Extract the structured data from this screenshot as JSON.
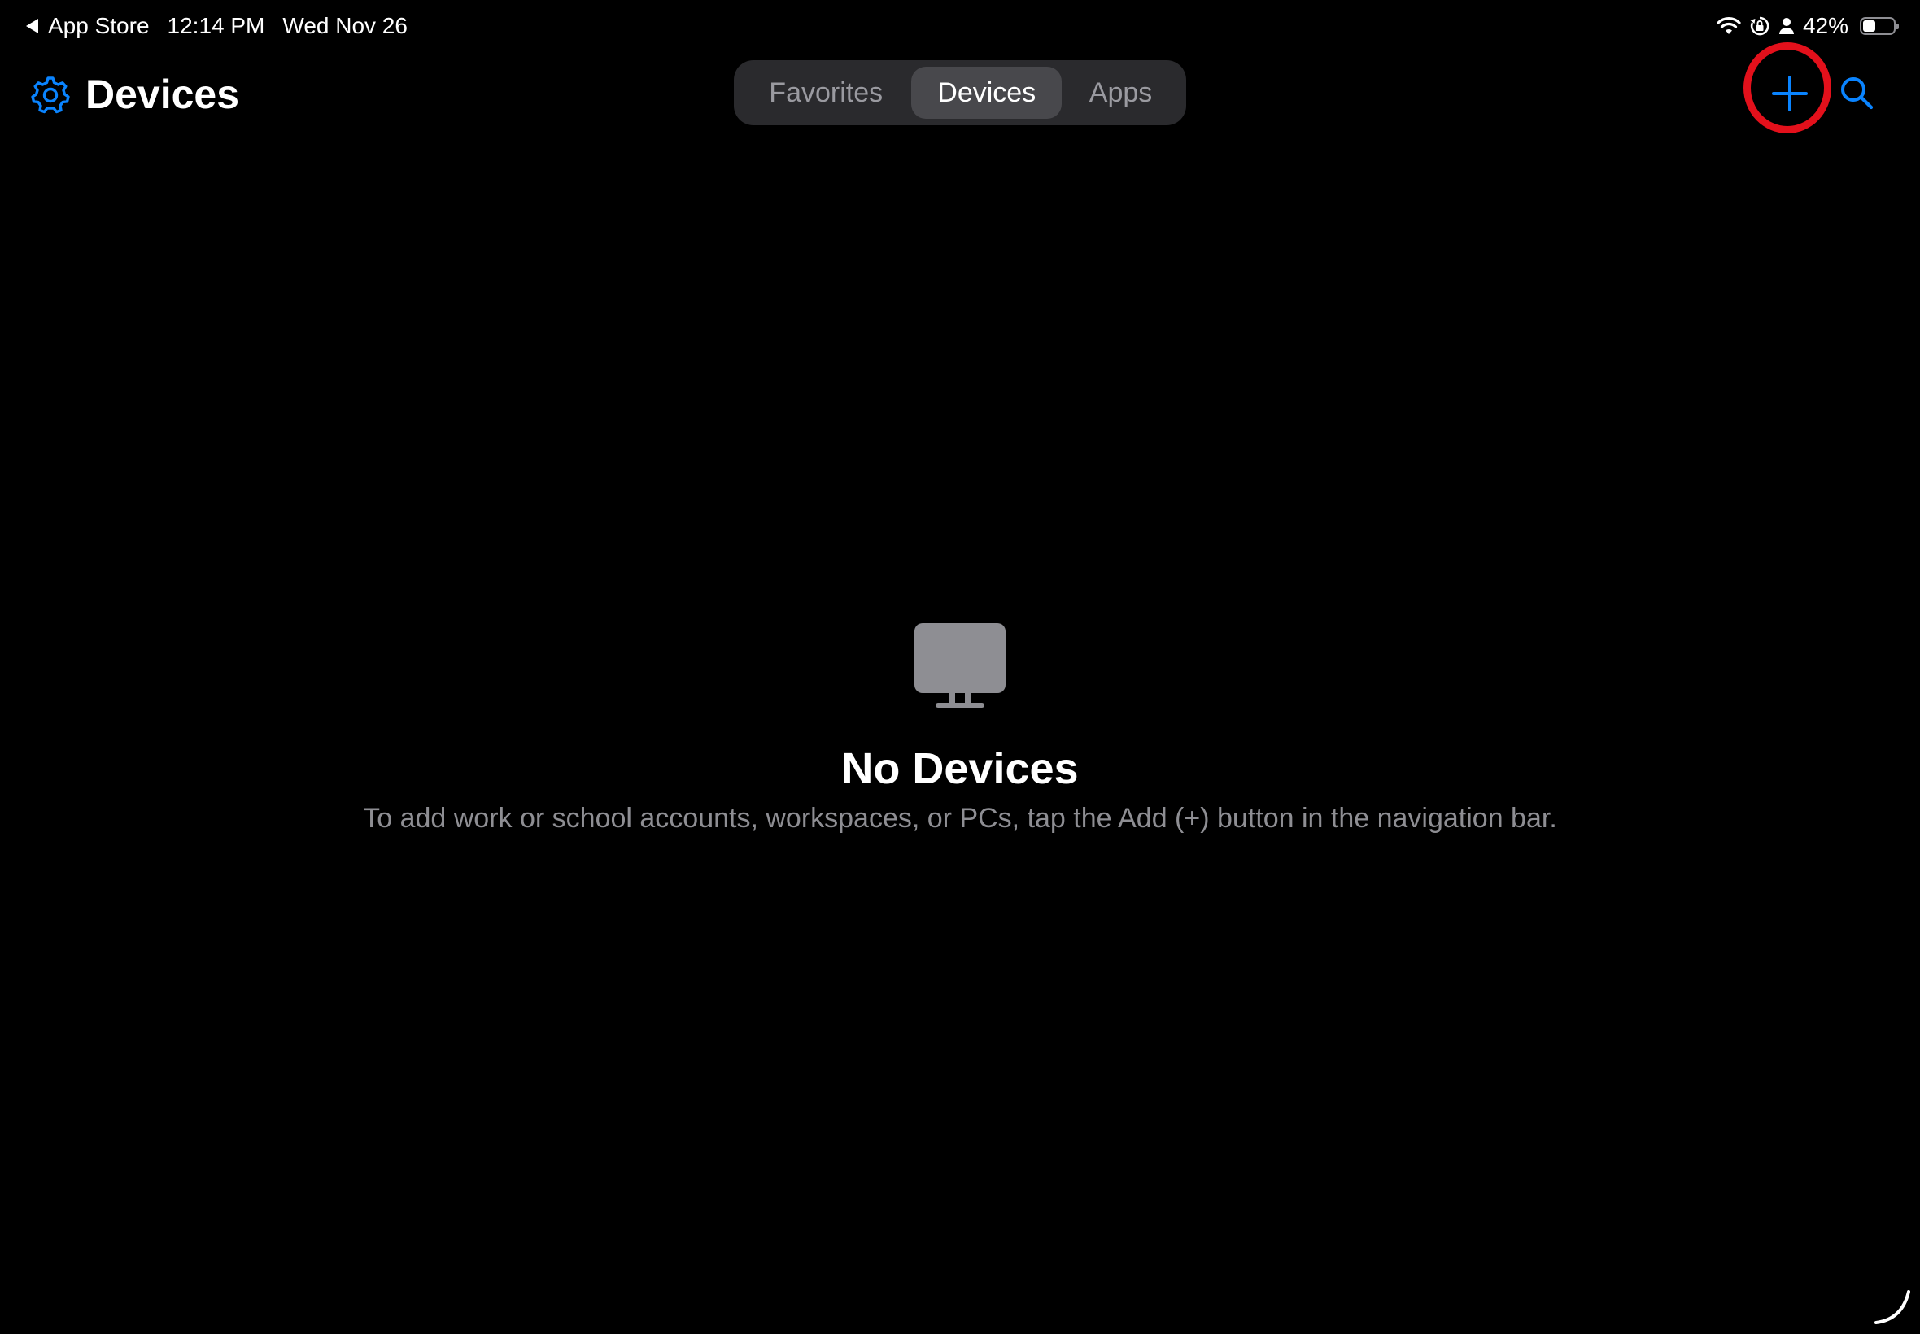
{
  "status_bar": {
    "back_app": "App Store",
    "time": "12:14 PM",
    "date": "Wed Nov 26",
    "battery_percent": "42%",
    "battery_level": 0.42,
    "icons": [
      "wifi-icon",
      "orientation-lock-icon",
      "person-icon",
      "battery-icon"
    ]
  },
  "nav": {
    "title": "Devices",
    "settings_icon": "gear-icon",
    "add_icon": "plus-icon",
    "search_icon": "search-icon",
    "accent_color": "#0a84ff",
    "highlight_color": "#e3101b"
  },
  "tabs": {
    "items": [
      {
        "label": "Favorites",
        "selected": false
      },
      {
        "label": "Devices",
        "selected": true
      },
      {
        "label": "Apps",
        "selected": false
      }
    ]
  },
  "empty_state": {
    "icon": "monitor-icon",
    "title": "No Devices",
    "message": "To add work or school accounts, workspaces, or PCs, tap the Add (+) button in the navigation bar."
  }
}
